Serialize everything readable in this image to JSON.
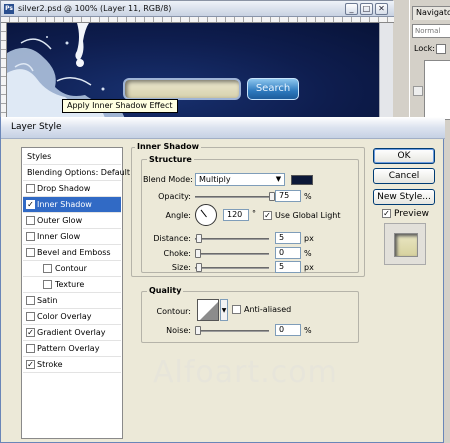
{
  "document": {
    "title": "silver2.psd @ 100% (Layer 11, RGB/8)",
    "ps_icon": "Ps",
    "minimize": "_",
    "maximize": "□",
    "close": "✕",
    "search_button": "Search"
  },
  "navigator": {
    "tab": "Navigator",
    "blend": "Normal",
    "lock_label": "Lock:"
  },
  "dialog": {
    "title": "Layer Style",
    "styles_list": [
      {
        "label": "Styles",
        "checked": null
      },
      {
        "label": "Blending Options: Default",
        "checked": null
      },
      {
        "label": "Drop Shadow",
        "checked": false
      },
      {
        "label": "Inner Shadow",
        "checked": true,
        "selected": true
      },
      {
        "label": "Outer Glow",
        "checked": false
      },
      {
        "label": "Inner Glow",
        "checked": false
      },
      {
        "label": "Bevel and Emboss",
        "checked": false
      },
      {
        "label": "Contour",
        "checked": false
      },
      {
        "label": "Texture",
        "checked": false
      },
      {
        "label": "Satin",
        "checked": false
      },
      {
        "label": "Color Overlay",
        "checked": false
      },
      {
        "label": "Gradient Overlay",
        "checked": true
      },
      {
        "label": "Pattern Overlay",
        "checked": false
      },
      {
        "label": "Stroke",
        "checked": true
      }
    ],
    "tooltip": "Apply Inner Shadow Effect",
    "inner_shadow": {
      "title": "Inner Shadow",
      "structure": {
        "title": "Structure",
        "blend_mode_label": "Blend Mode:",
        "blend_mode": "Multiply",
        "shadow_color": "#0c1838",
        "opacity_label": "Opacity:",
        "opacity": "75",
        "opacity_unit": "%",
        "angle_label": "Angle:",
        "angle": "120",
        "angle_unit": "°",
        "global_light_label": "Use Global Light",
        "global_light": true,
        "distance_label": "Distance:",
        "distance": "5",
        "distance_unit": "px",
        "choke_label": "Choke:",
        "choke": "0",
        "choke_unit": "%",
        "size_label": "Size:",
        "size": "5",
        "size_unit": "px"
      },
      "quality": {
        "title": "Quality",
        "contour_label": "Contour:",
        "anti_aliased_label": "Anti-aliased",
        "anti_aliased": false,
        "noise_label": "Noise:",
        "noise": "0",
        "noise_unit": "%"
      }
    },
    "buttons": {
      "ok": "OK",
      "cancel": "Cancel",
      "new_style": "New Style...",
      "preview_label": "Preview"
    },
    "preview": true,
    "watermark": "Alfoart.com"
  }
}
